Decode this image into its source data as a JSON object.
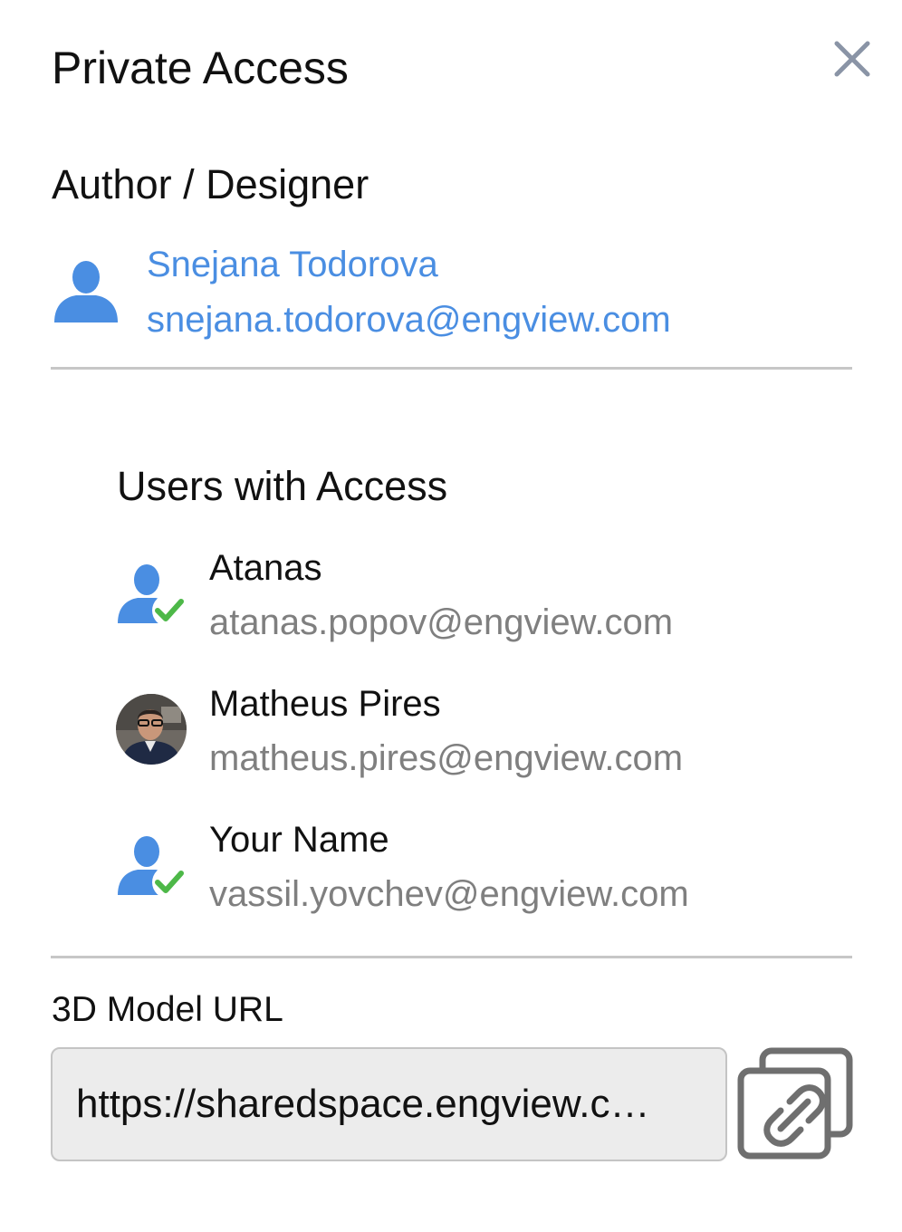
{
  "dialog": {
    "title": "Private Access",
    "close_icon": "close-icon"
  },
  "author": {
    "heading": "Author / Designer",
    "name": "Snejana Todorova",
    "email": "snejana.todorova@engview.com",
    "icon": "user-icon",
    "color": "#4a8ee2"
  },
  "users": {
    "heading": "Users with Access",
    "items": [
      {
        "name": "Atanas",
        "email": "atanas.popov@engview.com",
        "icon": "user-check-icon"
      },
      {
        "name": "Matheus Pires",
        "email": "matheus.pires@engview.com",
        "icon": "avatar-photo"
      },
      {
        "name": "Your Name",
        "email": "vassil.yovchev@engview.com",
        "icon": "user-check-icon"
      }
    ],
    "check_color": "#4db848"
  },
  "model_url": {
    "label": "3D Model URL",
    "value": "https://sharedspace.engview.c…",
    "copy_icon": "copy-link-icon"
  }
}
